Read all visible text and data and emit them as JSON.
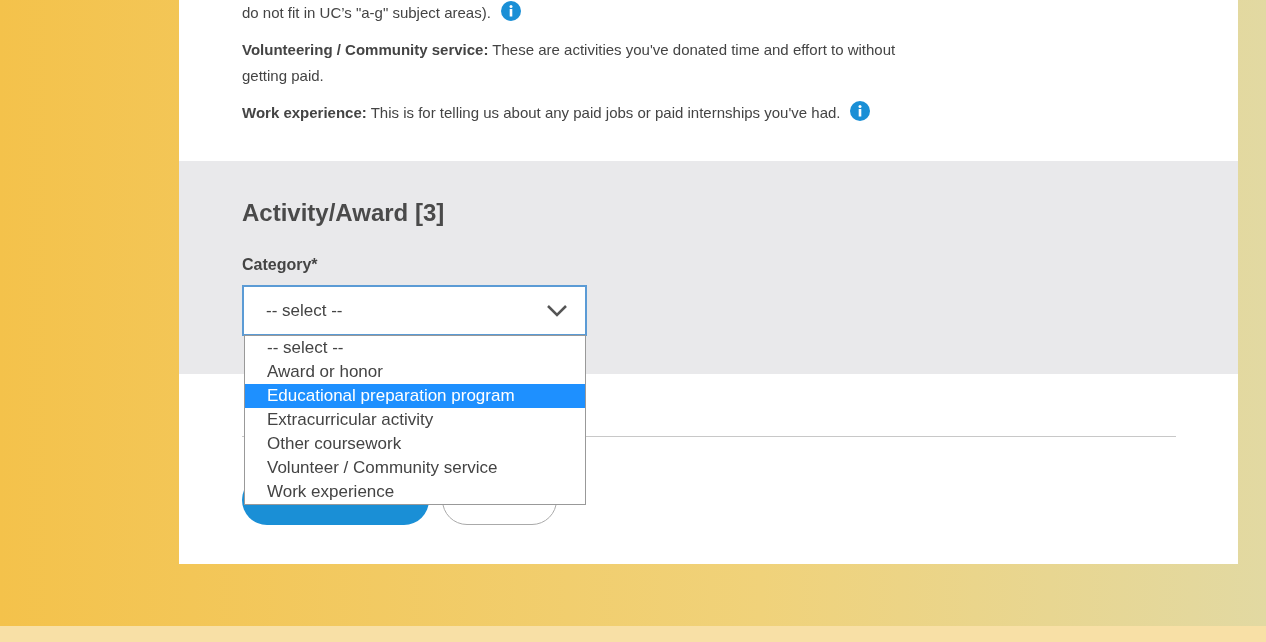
{
  "intro": [
    {
      "text": "do not fit in UC’s \"a-g\" subject areas).",
      "info": true
    },
    {
      "text": "**Volunteering / Community service:** These are activities you've donated time and effort to without getting paid.",
      "info": false
    },
    {
      "text": "**Work experience:** This is for telling us about any paid jobs or paid internships you've had.",
      "info": true
    }
  ],
  "section": {
    "title": "Activity/Award [3]",
    "field": {
      "label": "Category*",
      "value": "-- select --",
      "expanded": true,
      "options": [
        {
          "label": "-- select --",
          "highlighted": false
        },
        {
          "label": "Award or honor",
          "highlighted": false
        },
        {
          "label": "Educational preparation program",
          "highlighted": true
        },
        {
          "label": "Extracurricular activity",
          "highlighted": false
        },
        {
          "label": "Other coursework",
          "highlighted": false
        },
        {
          "label": "Volunteer / Community service",
          "highlighted": false
        },
        {
          "label": "Work experience",
          "highlighted": false
        }
      ]
    }
  },
  "buttons": [
    {
      "kind": "primary"
    },
    {
      "kind": "secondary"
    }
  ]
}
